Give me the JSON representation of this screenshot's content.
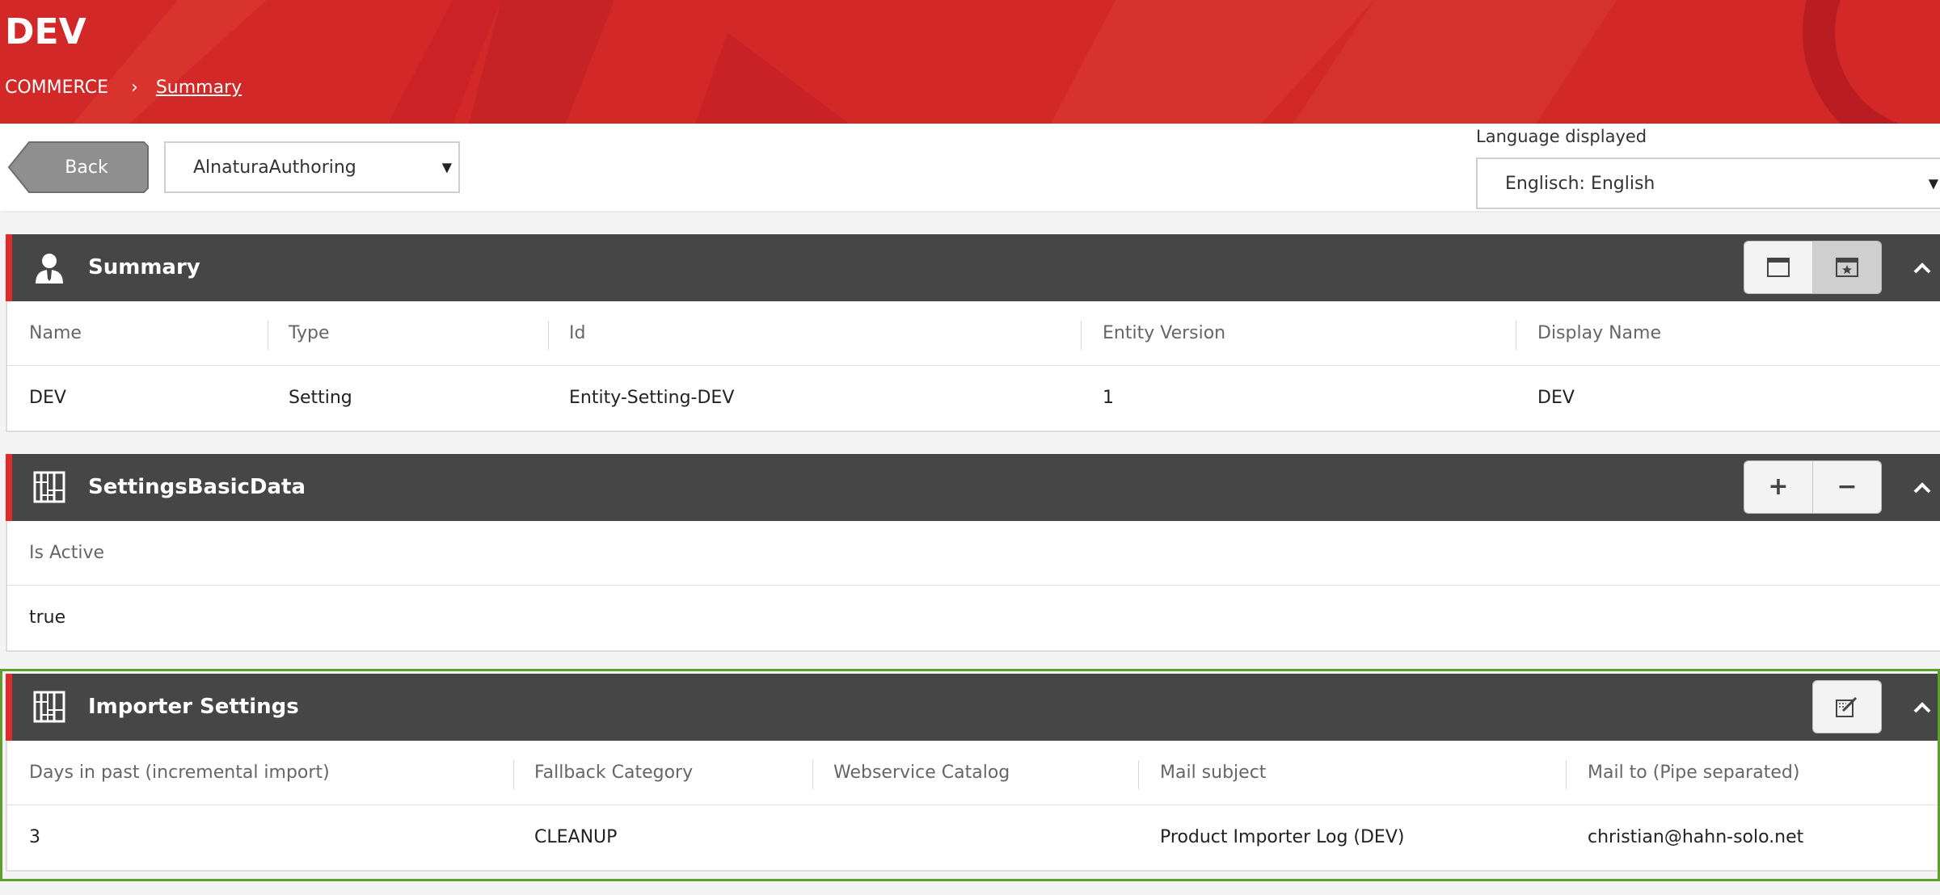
{
  "header": {
    "title": "DEV",
    "breadcrumb": [
      {
        "label": "COMMERCE"
      },
      {
        "label": "Summary"
      }
    ],
    "breadcrumb_separator": "›",
    "background_color": "#d42a2a"
  },
  "toolbar": {
    "back_label": "Back",
    "dataset_select": {
      "value": "AlnaturaAuthoring"
    },
    "language": {
      "label": "Language displayed",
      "value": "Englisch: English"
    }
  },
  "panels": {
    "summary": {
      "title": "Summary",
      "columns": [
        "Name",
        "Type",
        "Id",
        "Entity Version",
        "Display Name"
      ],
      "row": [
        "DEV",
        "Setting",
        "Entity-Setting-DEV",
        "1",
        "DEV"
      ]
    },
    "basic_data": {
      "title": "SettingsBasicData",
      "columns": [
        "Is Active"
      ],
      "row": [
        "true"
      ],
      "buttons": {
        "add": "+",
        "remove": "−"
      }
    },
    "importer": {
      "title": "Importer Settings",
      "columns": [
        "Days in past (incremental import)",
        "Fallback Category",
        "Webservice Catalog",
        "Mail subject",
        "Mail to (Pipe separated)"
      ],
      "row": [
        "3",
        "CLEANUP",
        "",
        "Product Importer Log (DEV)",
        "christian@hahn-solo.net"
      ]
    }
  },
  "colors": {
    "panel_header": "#464646",
    "accent_red": "#e02a2a",
    "highlight_green": "#5ca12e"
  },
  "icons": {
    "summary": "user-icon",
    "basic_data": "grid-icon",
    "importer": "grid-icon",
    "view_window": "window-icon",
    "view_favorite": "star-window-icon",
    "edit": "edit-icon",
    "collapse": "chevron-up-icon"
  }
}
